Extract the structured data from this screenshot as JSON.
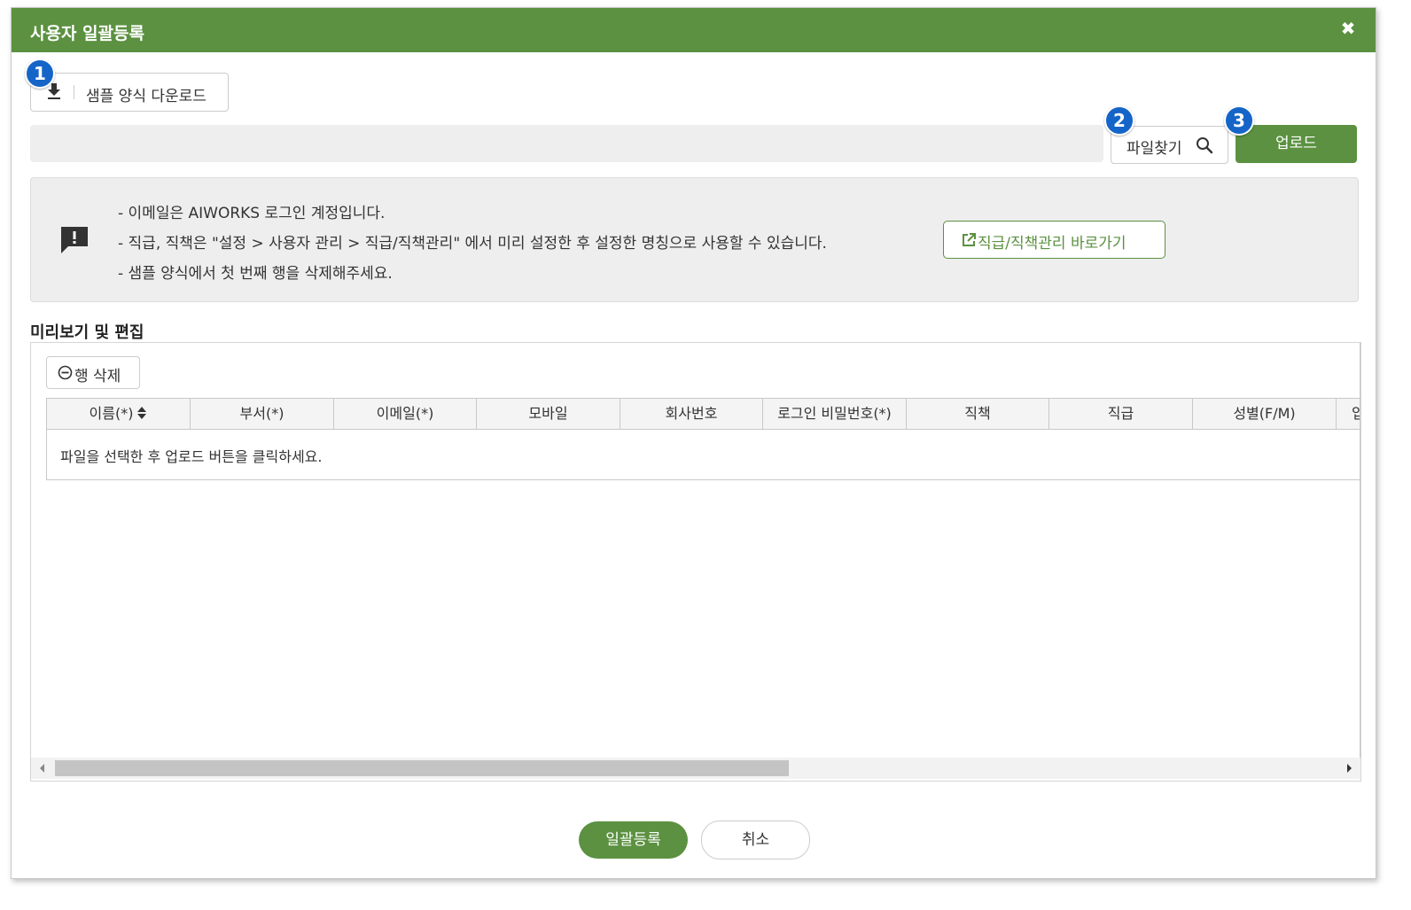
{
  "dialog": {
    "title": "사용자 일괄등록",
    "close_icon": "close-icon"
  },
  "markers": [
    "1",
    "2",
    "3"
  ],
  "toolbar": {
    "sample_download_label": "샘플 양식 다운로드",
    "sample_download_icon": "download-icon",
    "file_path_value": "",
    "find_file_label": "파일찾기",
    "find_file_icon": "search-icon",
    "upload_label": "업로드"
  },
  "notice": {
    "icon": "comment-alert-icon",
    "lines": [
      "- 이메일은 AIWORKS 로그인 계정입니다.",
      "- 직급, 직책은 \"설정 > 사용자 관리 > 직급/직책관리\" 에서 미리 설정한 후 설정한 명칭으로 사용할 수 있습니다.",
      "- 샘플 양식에서 첫 번째 행을 삭제해주세요."
    ],
    "shortcut_label": "직급/직책관리 바로가기",
    "shortcut_icon": "external-link-icon"
  },
  "preview": {
    "section_title": "미리보기 및 편집",
    "delete_row_label": "행 삭제",
    "delete_row_icon": "minus-circle-icon",
    "columns": [
      "이름(*)",
      "부서(*)",
      "이메일(*)",
      "모바일",
      "회사번호",
      "로그인 비밀번호(*)",
      "직책",
      "직급",
      "성별(F/M)",
      "입"
    ],
    "sort_icon": "sort-icon",
    "empty_message": "파일을 선택한 후 업로드 버튼을 클릭하세요."
  },
  "footer": {
    "bulk_register_label": "일괄등록",
    "cancel_label": "취소"
  },
  "colors": {
    "primary_green": "#5b9140",
    "marker_blue": "#1565c8",
    "panel_gray": "#eeeeee"
  }
}
